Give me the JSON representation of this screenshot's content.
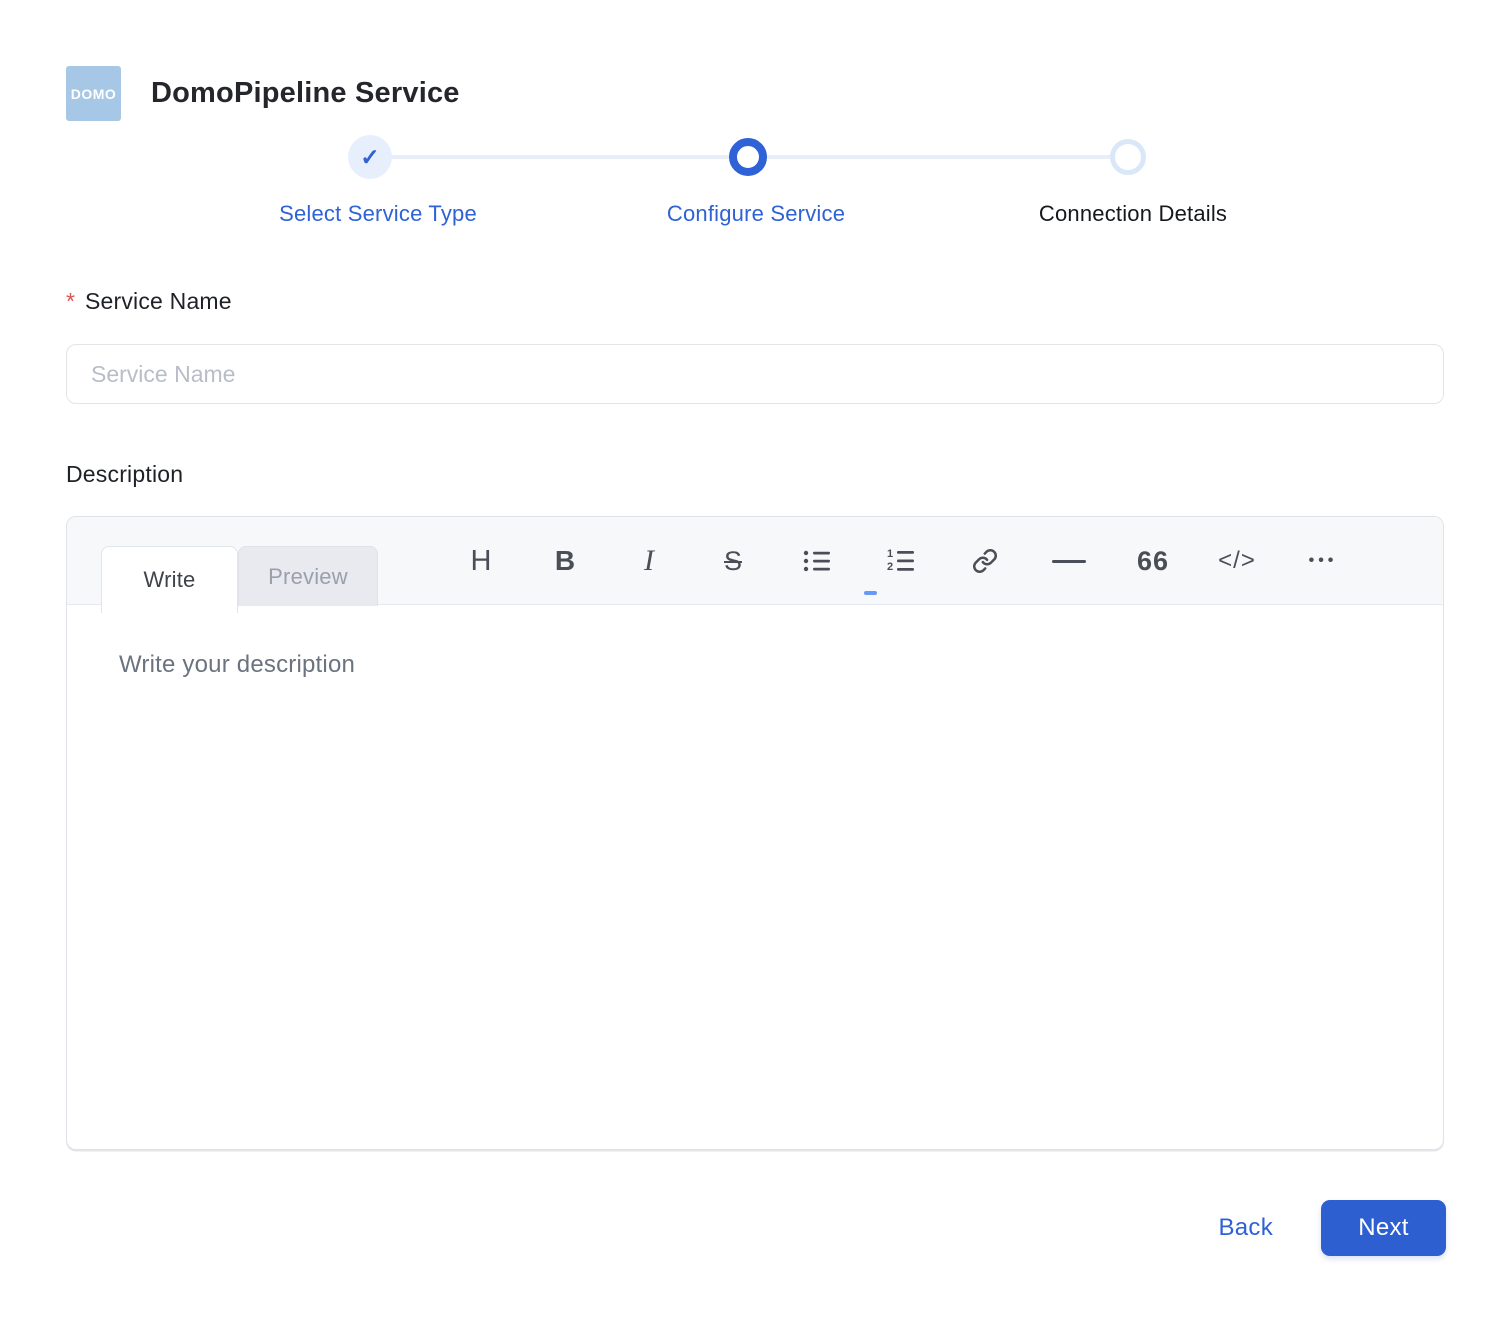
{
  "app": {
    "title": "DomoPipeline Service",
    "logo_text": "DOMO"
  },
  "stepper": {
    "steps": [
      {
        "label": "Select Service Type",
        "state": "completed",
        "icon": "check"
      },
      {
        "label": "Configure Service",
        "state": "current",
        "icon": "ring"
      },
      {
        "label": "Connection Details",
        "state": "upcoming",
        "icon": "ring-light"
      }
    ],
    "check_glyph": "✓"
  },
  "form": {
    "service_name": {
      "label": "Service Name",
      "required_marker": "*",
      "placeholder": "Service Name",
      "value": ""
    },
    "description": {
      "label": "Description",
      "placeholder": "Write your description",
      "value": ""
    }
  },
  "editor": {
    "tabs": [
      {
        "label": "Write",
        "active": true
      },
      {
        "label": "Preview",
        "active": false
      }
    ],
    "toolbar": [
      {
        "name": "heading",
        "glyph": "H"
      },
      {
        "name": "bold",
        "glyph": "B"
      },
      {
        "name": "italic",
        "glyph": "I"
      },
      {
        "name": "strikethrough",
        "glyph": "S"
      },
      {
        "name": "unordered-list",
        "glyph": ""
      },
      {
        "name": "ordered-list",
        "glyph": ""
      },
      {
        "name": "link",
        "glyph": ""
      },
      {
        "name": "horizontal-rule",
        "glyph": ""
      },
      {
        "name": "quote",
        "glyph": "66"
      },
      {
        "name": "code",
        "glyph": "</>"
      },
      {
        "name": "more",
        "glyph": "•••"
      }
    ]
  },
  "footer": {
    "back_label": "Back",
    "next_label": "Next"
  },
  "colors": {
    "accent_blue": "#2e62d6",
    "button_blue": "#2d5fd0",
    "logo_blue": "#a7c7e7",
    "step_done_bg": "#e7effc",
    "step_upcoming_ring": "#d9e7f8",
    "required_red": "#e05252",
    "toolbar_icon": "#4a4e57",
    "placeholder_gray": "#b8bdc7",
    "editor_placeholder": "#6b7380",
    "header_bg": "#f7f8fa"
  }
}
